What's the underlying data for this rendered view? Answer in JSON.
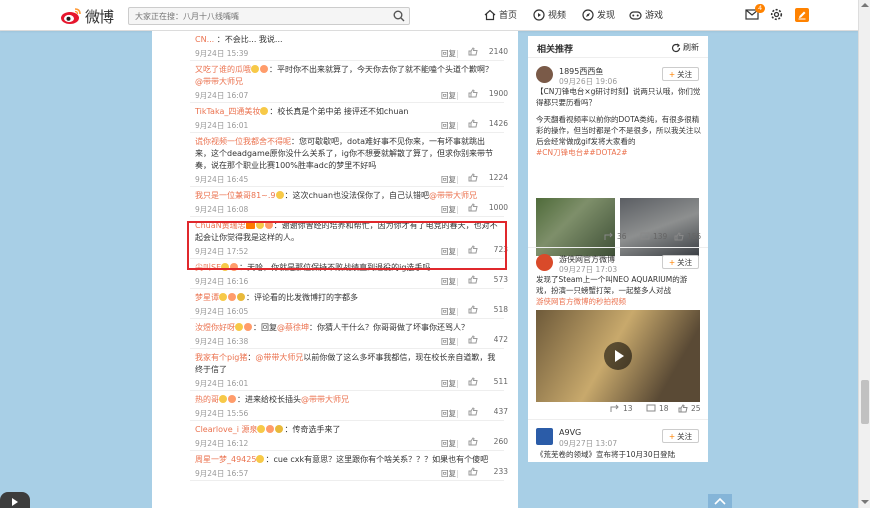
{
  "header": {
    "logo_text": "微博",
    "search_placeholder": "大家正在搜：八月十八线嘴嘴",
    "nav": [
      {
        "label": "首页",
        "icon": "home-icon"
      },
      {
        "label": "视频",
        "icon": "video-icon"
      },
      {
        "label": "发现",
        "icon": "discover-icon"
      },
      {
        "label": "游戏",
        "icon": "game-icon"
      }
    ],
    "message_badge": "4"
  },
  "comments": [
    {
      "user": "CN... ",
      "text": "：不会比... 我说...",
      "date": "9月24日 15:39",
      "reply": "回复",
      "likes": "2140",
      "partial": true
    },
    {
      "user": "又吃了谁的瓜哦",
      "emoji": 2,
      "text": "：平时你不出来就算了，今天你去你了就不能嗑个头道个歉啊？",
      "mention": "@带带大师兄",
      "date": "9月24日 16:07",
      "reply": "回复",
      "likes": "1900"
    },
    {
      "user": "TikTaka_四通美妆",
      "emoji": 1,
      "text": "：校长真是个弟中弟 接评还不如chuan",
      "date": "9月24日 16:01",
      "reply": "回复",
      "likes": "1426"
    },
    {
      "user": "谎你视频一位我都舍不得呢",
      "text": "：您可歇歇吧，dota难好事不见你来，一有坏事就跳出来，这个deadgame原你没什么关系了，ig你不想要就解散了算了，但求你别来带节奏，说在那个职业比赛100%胜率adc的梦里不好吗",
      "date": "9月24日 16:45",
      "reply": "回复",
      "likes": "1224"
    },
    {
      "user": "我只是一位兼哥81~.9",
      "emoji": 1,
      "text": "：这次chuan也没法保你了，自己认错吧",
      "mention": "@带带大师兄",
      "date": "9月24日 16:08",
      "reply": "回复",
      "likes": "1000"
    },
    {
      "user": "ChuaN黄瑞忠",
      "emoji": 2,
      "badge": true,
      "text": "：谢谢你曾经的培养和帮忙，因为你才有了电竞的春天，也对不起会让你觉得我是这样的人。",
      "date": "9月24日 17:52",
      "reply": "回复",
      "likes": "723",
      "highlight": true
    },
    {
      "user": "尖叫SE",
      "emoji": 2,
      "text": "：天哈，你就是那位保持不败战绩直到退役的ig选手吗",
      "date": "9月24日 16:16",
      "reply": "回复",
      "likes": "573"
    },
    {
      "user": "梦星谭",
      "emoji": 3,
      "text": "：评论看的比发微博打的字都多",
      "date": "9月24日 16:05",
      "reply": "回复",
      "likes": "518"
    },
    {
      "user": "汝煜你好呀",
      "emoji": 2,
      "text": "：回复",
      "mention": "@蔡徐坤",
      "text2": "：你猜人干什么？你哥哥做了坏事你还骂人？",
      "date": "9月24日 16:38",
      "reply": "回复",
      "likes": "472"
    },
    {
      "user": "我家有个pig猪",
      "text": "：",
      "mention": "@带带大师兄",
      "text2": "以前你做了这么多坏事我都信，现在校长亲自道歉，我终于信了",
      "date": "9月24日 16:01",
      "reply": "回复",
      "likes": "511"
    },
    {
      "user": "热的哥",
      "emoji": 2,
      "text": "：进来给校长插头",
      "mention": "@带带大师兄",
      "date": "9月24日 15:56",
      "reply": "回复",
      "likes": "437"
    },
    {
      "user": "Clearlove_i 源泉",
      "emoji": 3,
      "text": "：传奇选手来了",
      "date": "9月24日 16:12",
      "reply": "回复",
      "likes": "260"
    },
    {
      "user": "周星一梦_49425",
      "emoji": 1,
      "text": "：cue cxk有意思？这里跟你有个啥关系？？？如果也有个傻吧",
      "date": "9月24日 16:57",
      "reply": "回复",
      "likes": "233"
    }
  ],
  "sidebar": {
    "title": "相关推荐",
    "refresh_label": "刷新",
    "follow_label": "关注",
    "posts": [
      {
        "name": "1895西西鱼",
        "time": "09月26日 19:06",
        "text_lines": [
          "【CN刀锋电台×g研讨时刻】说两只认哦，你们觉得都只要历看吗？",
          "",
          "今天翻看视频率以前你的DOTA类纯，有很多很精彩的操作，但当时都是个不是很多，所以我关注以后会经常做成gif发将大家看的",
          "#CN刀锋电台##DOTA2#"
        ],
        "reposts": "36",
        "comments": "139",
        "likes": "155"
      },
      {
        "name": "游侠网官方微博",
        "time": "09月27日 17:03",
        "text_lines": [
          "发现了Steam上一个叫NEO AQUARIUM的游戏，扮演一只螃蟹打架，一起整多人对战",
          "游侠网官方微博的秒拍视频"
        ],
        "reposts": "13",
        "comments": "18",
        "likes": "25"
      },
      {
        "name": "A9VG",
        "time": "09月27日 13:07",
        "text_lines": [
          "《荒芜卷的领域》宣布将于10月30日登陆"
        ]
      }
    ]
  },
  "colors": {
    "accent": "#eb7350",
    "highlight": "#e0282c",
    "brand": "#ff8200"
  }
}
